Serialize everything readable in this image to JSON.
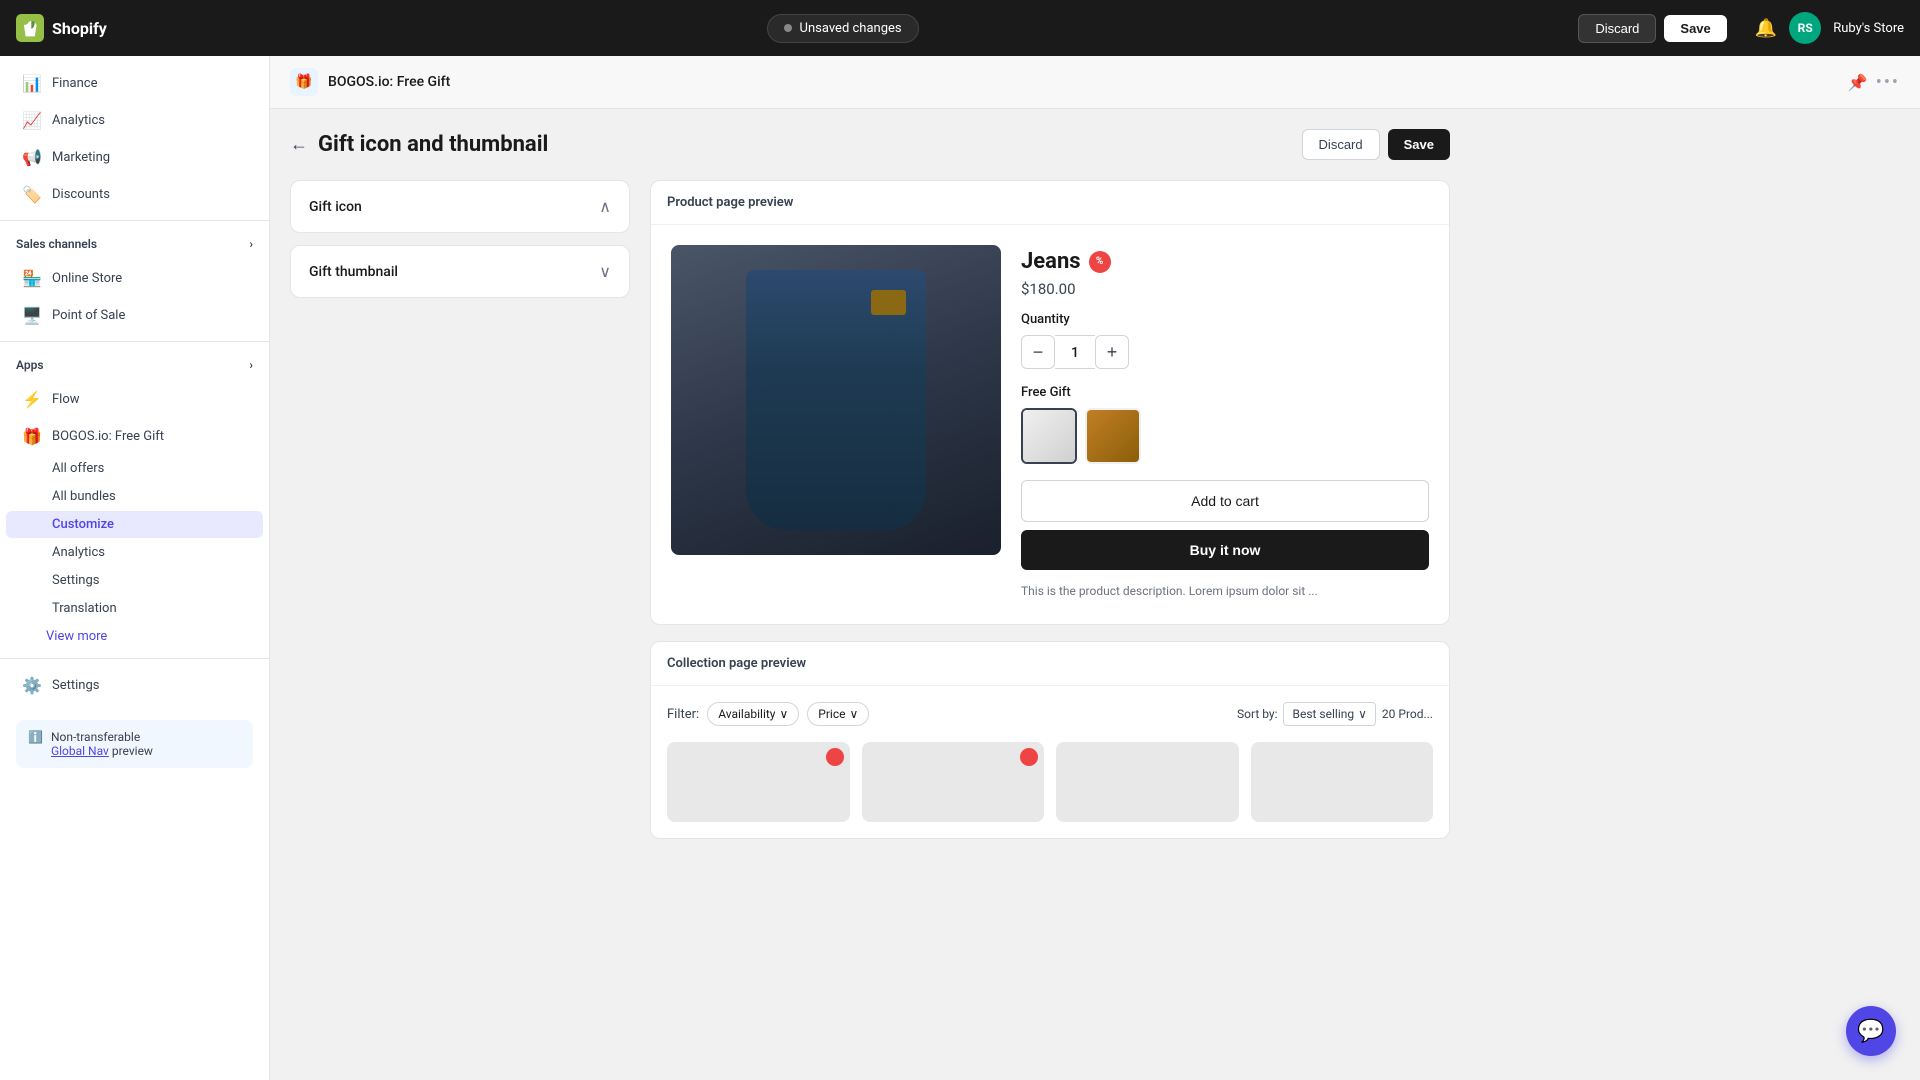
{
  "topbar": {
    "logo_text": "Shopify",
    "unsaved_label": "Unsaved changes",
    "discard_label": "Discard",
    "save_label": "Save",
    "store_name": "Ruby's Store",
    "avatar_initials": "RS"
  },
  "sidebar": {
    "finance_label": "Finance",
    "analytics_label": "Analytics",
    "marketing_label": "Marketing",
    "discounts_label": "Discounts",
    "sales_channels_label": "Sales channels",
    "online_store_label": "Online Store",
    "point_of_sale_label": "Point of Sale",
    "apps_label": "Apps",
    "flow_label": "Flow",
    "bogos_label": "BOGOS.io: Free Gift",
    "all_offers_label": "All offers",
    "all_bundles_label": "All bundles",
    "customize_label": "Customize",
    "analytics_sub_label": "Analytics",
    "settings_sub_label": "Settings",
    "translation_sub_label": "Translation",
    "view_more_label": "View more",
    "settings_bottom_label": "Settings",
    "non_transferable_line1": "Non-transferable",
    "non_transferable_link": "Global Nav",
    "non_transferable_line2": " preview"
  },
  "content_header": {
    "app_name": "BOGOS.io: Free Gift"
  },
  "page": {
    "title": "Gift icon and thumbnail",
    "discard_label": "Discard",
    "save_label": "Save"
  },
  "gift_icon_section": {
    "label": "Gift icon"
  },
  "gift_thumbnail_section": {
    "label": "Gift thumbnail"
  },
  "product_preview": {
    "label": "Product page preview",
    "product_name": "Jeans",
    "product_price": "$180.00",
    "quantity_label": "Quantity",
    "quantity_value": "1",
    "free_gift_label": "Free Gift",
    "add_to_cart_label": "Add to cart",
    "buy_now_label": "Buy it now",
    "description": "This is the product description. Lorem ipsum dolor sit ..."
  },
  "collection_preview": {
    "label": "Collection page preview",
    "filter_label": "Filter:",
    "availability_label": "Availability",
    "price_label": "Price",
    "sort_by_label": "Sort by:",
    "best_selling_label": "Best selling",
    "product_count": "20 Prod..."
  }
}
